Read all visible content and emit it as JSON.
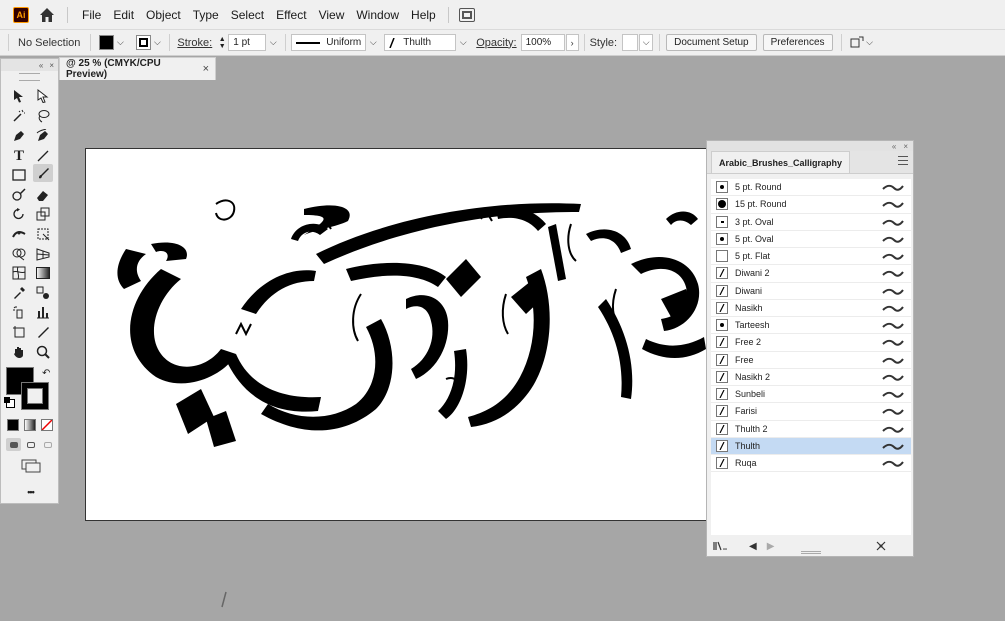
{
  "app": {
    "logo_text": "Ai"
  },
  "menu": [
    "File",
    "Edit",
    "Object",
    "Type",
    "Select",
    "Effect",
    "View",
    "Window",
    "Help"
  ],
  "control_bar": {
    "selection": "No Selection",
    "stroke_label": "Stroke:",
    "stroke_weight": "1 pt",
    "profile": "Uniform",
    "brush": "Thulth",
    "opacity_label": "Opacity:",
    "opacity": "100%",
    "style_label": "Style:",
    "document_setup": "Document Setup",
    "preferences": "Preferences"
  },
  "document_tab": {
    "title": "@ 25 % (CMYK/CPU Preview)",
    "close": "×"
  },
  "tools_panel": {
    "collapse": "«",
    "close": "×",
    "more": "•••"
  },
  "brushes_panel": {
    "title": "Arabic_Brushes_Calligraphy",
    "collapse": "«",
    "close": "×",
    "selected": "Thulth",
    "items": [
      {
        "name": "5 pt. Round",
        "thumb": "dot"
      },
      {
        "name": "15 pt. Round",
        "thumb": "bigdot"
      },
      {
        "name": "3 pt. Oval",
        "thumb": "smalldot"
      },
      {
        "name": "5 pt. Oval",
        "thumb": "dot"
      },
      {
        "name": "5 pt. Flat",
        "thumb": "none"
      },
      {
        "name": "Diwani 2",
        "thumb": "slash"
      },
      {
        "name": "Diwani",
        "thumb": "slash"
      },
      {
        "name": "Nasikh",
        "thumb": "slash"
      },
      {
        "name": "Tarteesh",
        "thumb": "dot"
      },
      {
        "name": "Free 2",
        "thumb": "slash"
      },
      {
        "name": "Free",
        "thumb": "slash"
      },
      {
        "name": "Nasikh 2",
        "thumb": "slash"
      },
      {
        "name": "Sunbeli",
        "thumb": "slash"
      },
      {
        "name": "Farisi",
        "thumb": "slash"
      },
      {
        "name": "Thulth 2",
        "thumb": "slash"
      },
      {
        "name": "Thulth",
        "thumb": "slash"
      },
      {
        "name": "Ruqa",
        "thumb": "slash"
      }
    ]
  },
  "colors": {
    "chrome": "#f0f0f0",
    "canvas": "#a6a6a6",
    "selected_row": "#c4daf3",
    "logo_bg": "#330000",
    "logo_fg": "#ff9a00"
  }
}
